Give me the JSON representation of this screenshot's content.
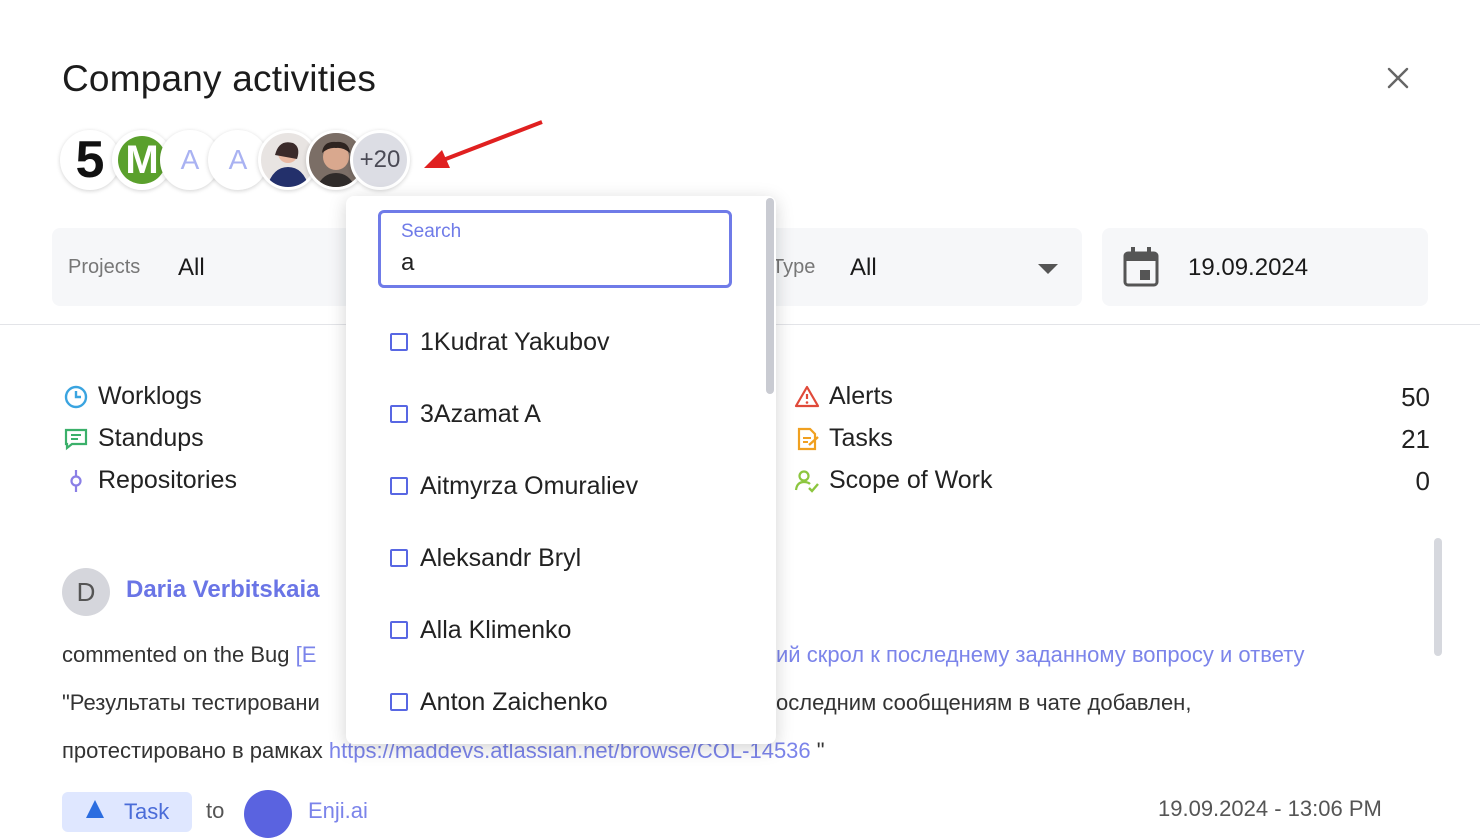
{
  "header": {
    "title": "Company activities",
    "avatars": {
      "first": "5",
      "second": "M",
      "third": "A",
      "fourth": "A",
      "more": "+20"
    }
  },
  "filters": {
    "projects_label": "Projects",
    "projects_value": "All",
    "type_label": "Type",
    "type_value": "All",
    "date_value": "19.09.2024"
  },
  "stats_left": [
    {
      "label": "Worklogs",
      "icon": "clock-icon"
    },
    {
      "label": "Standups",
      "icon": "chat-icon"
    },
    {
      "label": "Repositories",
      "icon": "commit-icon"
    }
  ],
  "stats_right": [
    {
      "label": "Alerts",
      "value": "50",
      "icon": "warning-icon"
    },
    {
      "label": "Tasks",
      "value": "21",
      "icon": "task-icon"
    },
    {
      "label": "Scope of Work",
      "value": "0",
      "icon": "person-check-icon"
    }
  ],
  "activity": {
    "avatar_letter": "D",
    "user_name": "Daria Verbitskaia",
    "line1_prefix": "commented on the Bug ",
    "line1_link_start": "[Е",
    "line1_link_end": "ий скрол к последнему заданному вопросу и ответу",
    "line2_start": "\"Результаты тестировани",
    "line2_end": "оследним сообщениям в чате добавлен,",
    "line3_prefix": "протестировано в рамках ",
    "line3_link": "https://maddevs.atlassian.net/browse/COL-14536",
    "line3_suffix": " \"",
    "chip_label": "Task",
    "to_text": "to",
    "project_name": "Enji.ai",
    "timestamp": "19.09.2024 - 13:06 PM"
  },
  "dropdown": {
    "search_label": "Search",
    "search_value": "a",
    "options": [
      "1Kudrat Yakubov",
      "3Azamat A",
      "Aitmyrza Omuraliev",
      "Aleksandr Bryl",
      "Alla Klimenko",
      "Anton Zaichenko"
    ]
  },
  "colors": {
    "accent": "#6f7be8",
    "link": "#7b84ea",
    "arrow": "#e02020"
  }
}
